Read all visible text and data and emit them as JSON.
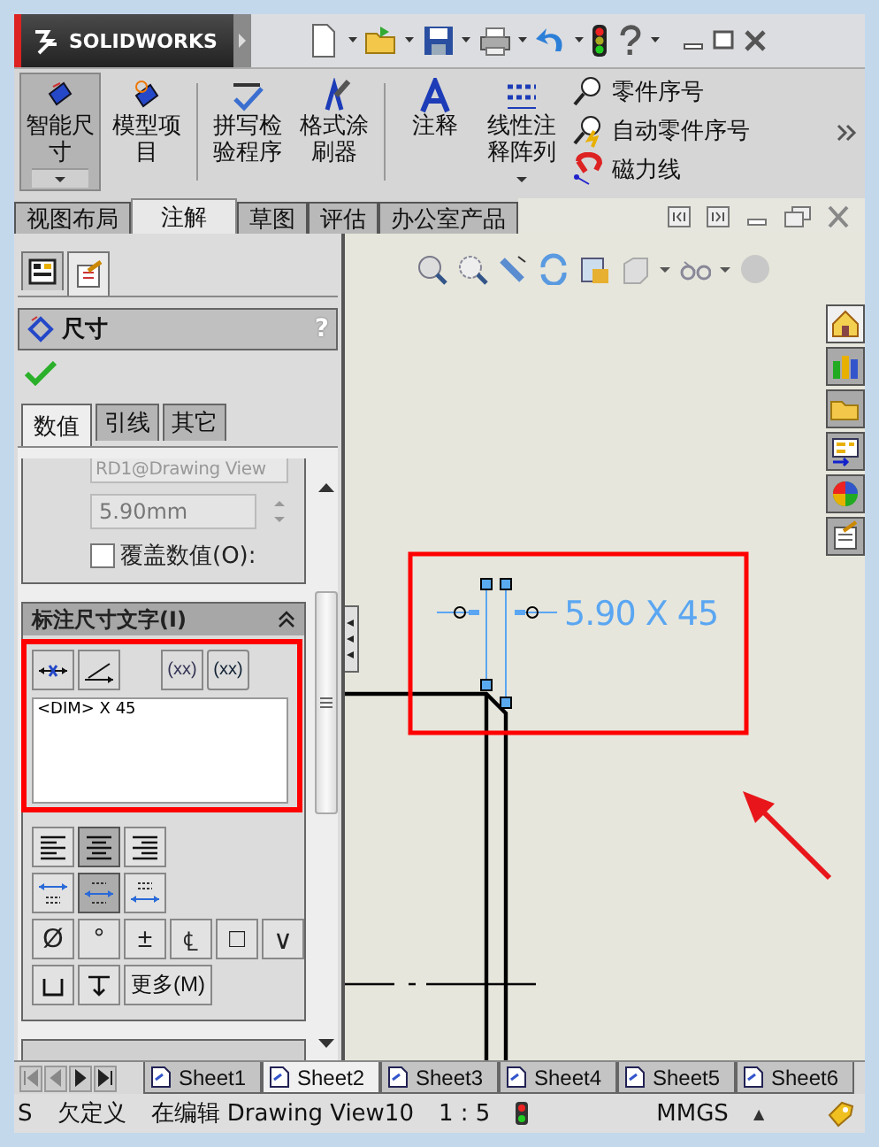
{
  "app": {
    "logo": "SOLIDWORKS"
  },
  "ribbon": {
    "large": [
      {
        "label": "智能尺寸",
        "selected": true,
        "dropdown": true
      },
      {
        "label": "模型项目",
        "selected": false,
        "dropdown": false
      },
      {
        "label": "拼写检验程序",
        "selected": false,
        "dropdown": false
      },
      {
        "label": "格式涂刷器",
        "selected": false,
        "dropdown": false
      },
      {
        "label": "注释",
        "selected": false,
        "dropdown": false
      },
      {
        "label": "线性注释阵列",
        "selected": false,
        "dropdown": true
      }
    ],
    "small": [
      {
        "label": "零件序号"
      },
      {
        "label": "自动零件序号"
      },
      {
        "label": "磁力线"
      }
    ]
  },
  "tabs": [
    {
      "label": "视图布局",
      "selected": false
    },
    {
      "label": "注解",
      "selected": true
    },
    {
      "label": "草图",
      "selected": false
    },
    {
      "label": "评估",
      "selected": false
    },
    {
      "label": "办公室产品",
      "selected": false
    }
  ],
  "panel": {
    "tabs": [
      {
        "selected": false
      },
      {
        "selected": true
      }
    ],
    "title": "尺寸",
    "help": "?",
    "value_tabs": [
      {
        "label": "数值",
        "selected": true
      },
      {
        "label": "引线",
        "selected": false
      },
      {
        "label": "其它",
        "selected": false
      }
    ],
    "reference": "RD1@Drawing View",
    "value": "5.90mm",
    "override": {
      "label": "覆盖数值(O):",
      "checked": false
    },
    "text_group": {
      "title": "标注尺寸文字(I)",
      "format_buttons": [
        "(xx)",
        "(xx)"
      ],
      "text": "<DIM> X 45",
      "justify": [
        {
          "selected": false
        },
        {
          "selected": true
        },
        {
          "selected": false
        }
      ],
      "placement": [
        {
          "selected": false
        },
        {
          "selected": true
        },
        {
          "selected": false
        }
      ],
      "symbols": [
        "Ø",
        "°",
        "±",
        "℄",
        "□",
        "∨"
      ],
      "more": "更多(M)"
    }
  },
  "drawing": {
    "dimension": "5.90 X 45"
  },
  "task_pane": [
    {
      "selected": true
    },
    {
      "selected": false
    },
    {
      "selected": false
    },
    {
      "selected": false
    },
    {
      "selected": false
    },
    {
      "selected": false
    }
  ],
  "sheets": [
    {
      "label": "Sheet1",
      "selected": false
    },
    {
      "label": "Sheet2",
      "selected": true
    },
    {
      "label": "Sheet3",
      "selected": false
    },
    {
      "label": "Sheet4",
      "selected": false
    },
    {
      "label": "Sheet5",
      "selected": false
    },
    {
      "label": "Sheet6",
      "selected": false
    }
  ],
  "status": {
    "hint": "S",
    "state": "欠定义",
    "editing": "在编辑 Drawing View10",
    "scale": "1 : 5",
    "units": "MMGS",
    "units_menu": "▲"
  }
}
